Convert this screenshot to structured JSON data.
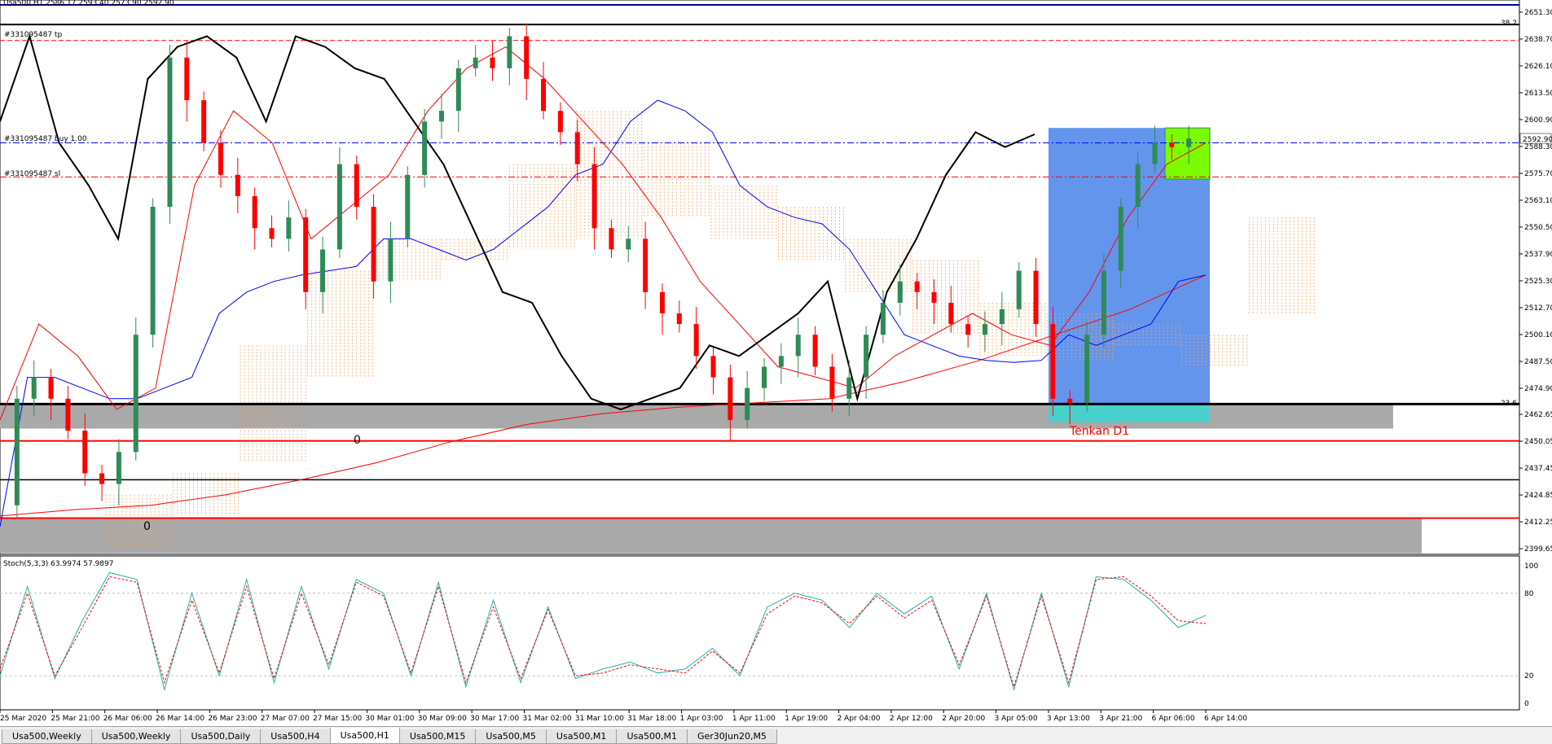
{
  "header_text": "Usa500,H1  2586.17 2593.40 2573.90 2592.90",
  "order_labels": {
    "tp": "#331095487 tp",
    "buy": "#331095487 buy 1.00",
    "sl": "#331095487 sl"
  },
  "fib_labels": {
    "upper": "38.2",
    "lower": "23.6"
  },
  "current_price": "2592.90",
  "price_ticks": [
    "2651.30",
    "2638.70",
    "2626.10",
    "2613.50",
    "2600.90",
    "2588.30",
    "2575.70",
    "2563.10",
    "2550.50",
    "2537.90",
    "2525.30",
    "2512.70",
    "2500.10",
    "2487.50",
    "2474.90",
    "2462.65",
    "2450.05",
    "2437.45",
    "2424.85",
    "2412.25",
    "2399.65"
  ],
  "time_ticks": [
    "25 Mar 2020",
    "25 Mar 21:00",
    "26 Mar 06:00",
    "26 Mar 14:00",
    "26 Mar 23:00",
    "27 Mar 07:00",
    "27 Mar 15:00",
    "30 Mar 01:00",
    "30 Mar 09:00",
    "30 Mar 17:00",
    "31 Mar 02:00",
    "31 Mar 10:00",
    "31 Mar 18:00",
    "1 Apr 03:00",
    "1 Apr 11:00",
    "1 Apr 19:00",
    "2 Apr 04:00",
    "2 Apr 12:00",
    "2 Apr 20:00",
    "3 Apr 05:00",
    "3 Apr 13:00",
    "3 Apr 21:00",
    "6 Apr 06:00",
    "6 Apr 14:00"
  ],
  "annotation": "Tenkan D1",
  "zero_labels": [
    "0",
    "0"
  ],
  "stoch": {
    "label": "Stoch(5,3,3) 63.9974 57.9897",
    "ticks": [
      "100",
      "80",
      "20",
      "0"
    ]
  },
  "tabs": [
    {
      "label": "Usa500,Weekly",
      "active": false
    },
    {
      "label": "Usa500,Weekly",
      "active": false
    },
    {
      "label": "Usa500,Daily",
      "active": false
    },
    {
      "label": "Usa500,H4",
      "active": false
    },
    {
      "label": "Usa500,H1",
      "active": true
    },
    {
      "label": "Usa500,M15",
      "active": false
    },
    {
      "label": "Usa500,M5",
      "active": false
    },
    {
      "label": "Usa500,M1",
      "active": false
    },
    {
      "label": "Usa500,M1",
      "active": false
    },
    {
      "label": "Ger30Jun20,M5",
      "active": false
    }
  ],
  "colors": {
    "bull": "#2e8b57",
    "bear": "#ff0000",
    "kijun": "#0000ff",
    "tenkan": "#ff0000",
    "chikou": "#000000",
    "cloud": "#f4a460",
    "buy_zone": "#6495ed",
    "target": "#7cfc00",
    "support": "#48d1cc",
    "zone_gray": "#a9a9a9",
    "stoch_main": "#20b2aa",
    "stoch_signal": "#ff0000"
  },
  "chart_data": {
    "type": "candlestick",
    "symbol": "Usa500",
    "timeframe": "H1",
    "ylim": [
      2397,
      2657
    ],
    "last": {
      "open": 2586.17,
      "high": 2593.4,
      "low": 2573.9,
      "close": 2592.9
    },
    "levels": {
      "take_profit": 2638.0,
      "buy": 2590.0,
      "stop_loss": 2574.0,
      "fib_38_2": 2645.5,
      "fib_23_6": 2467.5,
      "red_upper": 2450.2,
      "black_mid": 2432.0,
      "red_lower": 2414.0
    },
    "price_path": [
      2420,
      2470,
      2480,
      2470,
      2455,
      2435,
      2430,
      2445,
      2500,
      2560,
      2630,
      2610,
      2590,
      2575,
      2565,
      2550,
      2545,
      2555,
      2520,
      2540,
      2580,
      2560,
      2525,
      2545,
      2575,
      2600,
      2605,
      2625,
      2630,
      2625,
      2640,
      2620,
      2605,
      2595,
      2580,
      2550,
      2540,
      2545,
      2520,
      2510,
      2505,
      2490,
      2480,
      2460,
      2475,
      2485,
      2490,
      2500,
      2485,
      2470,
      2480,
      2500,
      2515,
      2525,
      2520,
      2515,
      2505,
      2500,
      2505,
      2512,
      2530,
      2505,
      2470,
      2468,
      2500,
      2530,
      2560,
      2580,
      2590,
      2588,
      2592
    ],
    "kijun": [
      2410,
      2480,
      2480,
      2475,
      2470,
      2470,
      2475,
      2480,
      2510,
      2520,
      2525,
      2528,
      2530,
      2532,
      2545,
      2545,
      2540,
      2535,
      2540,
      2550,
      2560,
      2575,
      2580,
      2600,
      2610,
      2605,
      2595,
      2570,
      2560,
      2555,
      2552,
      2540,
      2520,
      2500,
      2495,
      2490,
      2488,
      2487,
      2488,
      2500,
      2495,
      2500,
      2505,
      2525,
      2528
    ],
    "tenkan": [
      2460,
      2505,
      2490,
      2465,
      2475,
      2570,
      2605,
      2590,
      2545,
      2560,
      2575,
      2605,
      2625,
      2635,
      2620,
      2600,
      2580,
      2555,
      2525,
      2505,
      2485,
      2480,
      2475,
      2490,
      2500,
      2510,
      2500,
      2495,
      2520,
      2555,
      2580,
      2590
    ],
    "chikou": [
      2600,
      2640,
      2590,
      2570,
      2545,
      2620,
      2635,
      2640,
      2630,
      2600,
      2640,
      2635,
      2625,
      2620,
      2600,
      2580,
      2550,
      2520,
      2515,
      2490,
      2470,
      2465,
      2470,
      2475,
      2495,
      2490,
      2500,
      2510,
      2525,
      2470,
      2520,
      2545,
      2575,
      2595,
      2588,
      2594
    ],
    "long_ma": [
      2415,
      2418,
      2420,
      2425,
      2432,
      2440,
      2450,
      2458,
      2463,
      2466,
      2468,
      2470,
      2478,
      2488,
      2500,
      2512,
      2528
    ],
    "cloud": [
      [
        2425,
        2400
      ],
      [
        2435,
        2415
      ],
      [
        2495,
        2440
      ],
      [
        2530,
        2480
      ],
      [
        2545,
        2525
      ],
      [
        2545,
        2535
      ],
      [
        2580,
        2540
      ],
      [
        2605,
        2545
      ],
      [
        2590,
        2555
      ],
      [
        2570,
        2545
      ],
      [
        2560,
        2535
      ],
      [
        2545,
        2520
      ],
      [
        2535,
        2500
      ],
      [
        2515,
        2490
      ],
      [
        2510,
        2488
      ],
      [
        2505,
        2495
      ],
      [
        2500,
        2485
      ],
      [
        2555,
        2510
      ]
    ],
    "stoch_main": [
      20,
      85,
      18,
      60,
      95,
      90,
      10,
      80,
      20,
      90,
      15,
      85,
      25,
      90,
      80,
      20,
      88,
      12,
      75,
      15,
      70,
      18,
      25,
      30,
      22,
      25,
      40,
      20,
      70,
      80,
      75,
      55,
      80,
      65,
      78,
      25,
      80,
      10,
      80,
      12,
      92,
      90,
      75,
      55,
      64
    ],
    "stoch_signal": [
      25,
      80,
      20,
      55,
      92,
      88,
      15,
      75,
      22,
      85,
      18,
      80,
      28,
      88,
      78,
      22,
      85,
      15,
      70,
      18,
      68,
      20,
      22,
      28,
      25,
      22,
      38,
      22,
      65,
      78,
      73,
      58,
      78,
      62,
      75,
      28,
      78,
      12,
      78,
      15,
      90,
      92,
      78,
      60,
      58
    ]
  }
}
